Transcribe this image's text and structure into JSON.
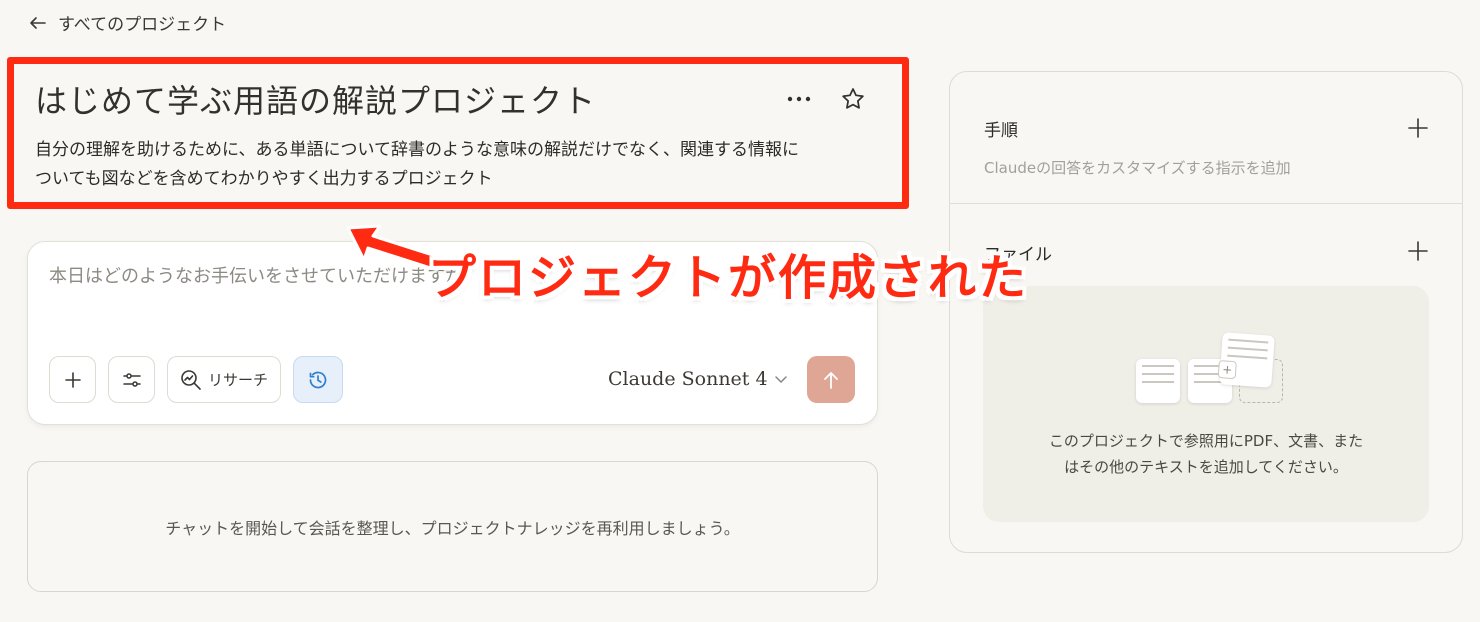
{
  "nav": {
    "back_label": "すべてのプロジェクト"
  },
  "project": {
    "title": "はじめて学ぶ用語の解説プロジェクト",
    "description_line1": "自分の理解を助けるために、ある単語について辞書のような意味の解説だけでなく、関連する情報に",
    "description_line2": "ついても図などを含めてわかりやすく出力するプロジェクト"
  },
  "chat": {
    "placeholder": "本日はどのようなお手伝いをさせていただけますか？",
    "research_label": "リサーチ",
    "model_label": "Claude Sonnet 4"
  },
  "empty_state": {
    "text": "チャットを開始して会話を整理し、プロジェクトナレッジを再利用しましょう。"
  },
  "side_panel": {
    "instructions_title": "手順",
    "instructions_hint": "Claudeの回答をカスタマイズする指示を追加",
    "files_title": "ファイル",
    "files_hint_line1": "このプロジェクトで参照用にPDF、文書、また",
    "files_hint_line2": "はその他のテキストを追加してください。"
  },
  "annotation": {
    "text": "プロジェクトが作成された",
    "color": "#ff2a12"
  },
  "colors": {
    "accent_send": "#dfa696",
    "background": "#f8f7f3",
    "active_tool": "#e6effa"
  }
}
